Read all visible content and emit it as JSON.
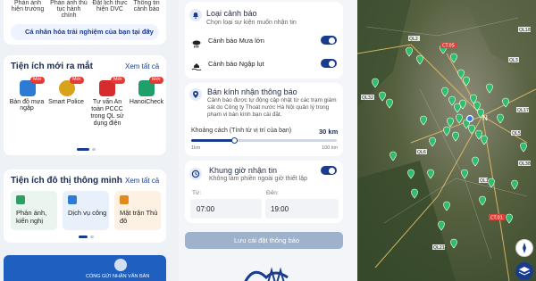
{
  "left": {
    "top_items": [
      "Phản ánh hiện trường",
      "Phản ánh thủ tục hành chính",
      "Đặt lịch thực hiện DVC",
      "Thông tin cảnh báo"
    ],
    "personalize_button": "Cá nhân hóa trải nghiệm của bạn tại đây",
    "new_section": {
      "title": "Tiện ích mới ra mắt",
      "see_all": "Xem tất cả",
      "badge": "Mới",
      "apps": [
        {
          "label": "Bản đồ mưa ngập",
          "color": "#2e7bd6"
        },
        {
          "label": "Smart Police",
          "color": "#d8a31b"
        },
        {
          "label": "Tư vấn An toàn PCCC trong QL sử dụng điện",
          "color": "#d72c2c"
        },
        {
          "label": "HanoiCheck",
          "color": "#1f9f6a"
        }
      ]
    },
    "smart_section": {
      "title": "Tiện ích đô thị thông minh",
      "see_all": "Xem tất cả",
      "items": [
        "Phản ánh, kiến nghị",
        "Dịch vụ công",
        "Mặt trận Thủ đô"
      ]
    },
    "banner_text": "CỔNG GỬI NHẬN VĂN BẢN"
  },
  "middle": {
    "alert_types": {
      "title": "Loại cảnh báo",
      "subtitle": "Chọn loại sự kiện muốn nhận tin",
      "options": [
        {
          "label": "Cảnh báo Mưa lớn",
          "on": true
        },
        {
          "label": "Cảnh báo Ngập lụt",
          "on": true
        }
      ]
    },
    "radius": {
      "title": "Bán kính nhận thông báo",
      "desc": "Cảnh báo được tự động cập nhật từ các trạm giám sát do Công ty Thoát nước Hà Nội quản lý trong phạm vi bán kính bạn cài đặt.",
      "distance_label": "Khoảng cách (Tính từ vị trí của bạn)",
      "distance_value": "30 km",
      "distance_fraction": 0.3,
      "min": "1km",
      "max": "100 km"
    },
    "time": {
      "title": "Khung giờ nhận tin",
      "subtitle": "Không làm phiền ngoài giờ thiết lập",
      "on": true,
      "from_label": "Từ:",
      "from_value": "07:00",
      "to_label": "Đến:",
      "to_value": "19:00"
    },
    "save_button": "Lưu cài đặt thông báo"
  },
  "map": {
    "labels": [
      "CT.05",
      "QL2",
      "QL3",
      "QL32",
      "QL6",
      "QL21",
      "QL1",
      "CT.01",
      "QL5",
      "QL38",
      "QL17",
      "QL18",
      "N"
    ]
  }
}
